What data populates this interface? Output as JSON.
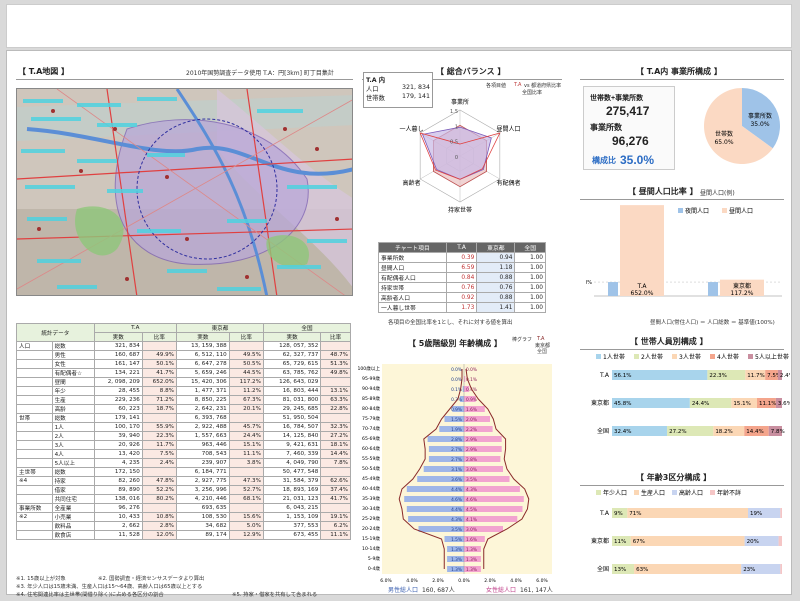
{
  "map_panel": {
    "title": "【 T.A地図 】",
    "note": "2010年国勢調査データ使用 T.A：円[3km] 町丁目集計"
  },
  "balance_panel": {
    "title": "【 総合バランス 】",
    "ta_label": "T.A 内",
    "population_label": "人口",
    "population_value": "321, 834",
    "households_label": "世帯数",
    "households_value": "179, 141",
    "legend_note": "各項目値",
    "legend_ta": "T.A",
    "legend_vs": "vs 都道府県比率",
    "legend_nat": "全国比率",
    "axes": [
      "事業所",
      "昼間人口",
      "有配偶者",
      "持家世帯",
      "高齢者",
      "一人暮し"
    ],
    "scale_labels": [
      "1.5",
      "1",
      "0.5",
      "0"
    ],
    "table_headers": [
      "チャート項目",
      "T.A",
      "東京都",
      "全国"
    ],
    "table_rows": [
      [
        "事業所数",
        "0.39",
        "0.94",
        "1.00"
      ],
      [
        "昼間人口",
        "6.59",
        "1.18",
        "1.00"
      ],
      [
        "有配偶者人口",
        "0.84",
        "0.88",
        "1.00"
      ],
      [
        "持家世帯",
        "0.76",
        "0.76",
        "1.00"
      ],
      [
        "高齢者人口",
        "0.92",
        "0.88",
        "1.00"
      ],
      [
        "一人暮し世帯",
        "1.73",
        "1.41",
        "1.00"
      ]
    ],
    "table_note": "各項目の全国比率を1とし、それに対する値を算出"
  },
  "establishment_panel": {
    "title": "【 T.A内 事業所構成 】",
    "label_total": "世帯数+事業所数",
    "value_total": "275,417",
    "label_est": "事業所数",
    "value_est": "96,276",
    "label_ratio": "構成比",
    "value_ratio": "35.0%",
    "pie_label_est": "事業所数",
    "pie_pct_est": "35.0%",
    "pie_label_hh": "世帯数",
    "pie_pct_hh": "65.0%",
    "share_est": 0.35,
    "color_est": "#9fc3e8",
    "color_hh": "#fbd9c3"
  },
  "daytime_panel": {
    "title": "【 昼間人口比率 】",
    "subtitle": "昼間人口(例)",
    "legend_night": "夜間人口",
    "legend_day": "昼間人口",
    "y_mid_label": "100%",
    "bars": [
      {
        "name": "T.A",
        "pct": "652.0%"
      },
      {
        "name": "東京都",
        "pct": "117.2%"
      }
    ],
    "formula": "昼間人口(常住人口) ＝ 人口総数 ＝ 基準値(100%)"
  },
  "household_panel": {
    "title": "【 世帯人員別構成 】",
    "legend": [
      "1人世帯",
      "2人世帯",
      "3人世帯",
      "4人世帯",
      "5人以上世帯"
    ],
    "colors": [
      "#a8d4ec",
      "#dde8b6",
      "#fbd7b5",
      "#f4a58c",
      "#c98fa0"
    ],
    "rows": [
      {
        "name": "T.A",
        "values": [
          56.1,
          22.3,
          11.7,
          7.5,
          2.4
        ],
        "labels": [
          "56.1%",
          "22.3%",
          "11.7%",
          "7.5%",
          "2.4%"
        ]
      },
      {
        "name": "東京都",
        "values": [
          45.8,
          24.4,
          15.1,
          11.1,
          3.6
        ],
        "labels": [
          "45.8%",
          "24.4%",
          "15.1%",
          "11.1%",
          "3.6%"
        ]
      },
      {
        "name": "全国",
        "values": [
          32.4,
          27.2,
          18.2,
          14.4,
          7.8
        ],
        "labels": [
          "32.4%",
          "27.2%",
          "18.2%",
          "14.4%",
          "7.8%"
        ]
      }
    ]
  },
  "age_panel": {
    "title": "【 年齢3区分構成 】",
    "legend": [
      "年少人口",
      "生産人口",
      "高齢人口",
      "年齢不詳"
    ],
    "colors": [
      "#dde8b6",
      "#fbd7b5",
      "#c8d4f0",
      "#f5c6c6"
    ],
    "rows": [
      {
        "name": "T.A",
        "values": [
          9,
          71,
          19,
          1
        ],
        "labels": [
          "9%",
          "71%",
          "19%",
          ""
        ]
      },
      {
        "name": "東京都",
        "values": [
          11,
          67,
          20,
          2
        ],
        "labels": [
          "11%",
          "67%",
          "20%",
          ""
        ]
      },
      {
        "name": "全国",
        "values": [
          13,
          63,
          23,
          1
        ],
        "labels": [
          "13%",
          "63%",
          "23%",
          ""
        ]
      }
    ]
  },
  "pyramid_panel": {
    "title": "【 5歳階級別 年齢構成 】",
    "legend_graph": "棒グラフ",
    "legend_line1": "T.A",
    "legend_line2": "東京都",
    "legend_line3": "全国",
    "male_label": "男性総人口",
    "male_value": "160, 687人",
    "female_label": "女性総人口",
    "female_value": "161, 147人",
    "axis_ticks": [
      "6.0%",
      "4.0%",
      "2.0%",
      "0.0%",
      "2.0%",
      "4.0%",
      "6.0%"
    ],
    "age_labels": [
      "100歳以上",
      "95-99歳",
      "90-94歳",
      "85-89歳",
      "80-84歳",
      "75-79歳",
      "70-74歳",
      "65-69歳",
      "60-64歳",
      "55-59歳",
      "50-54歳",
      "45-49歳",
      "40-44歳",
      "35-39歳",
      "30-34歳",
      "25-29歳",
      "20-24歳",
      "15-19歳",
      "10-14歳",
      "5-9歳",
      "0-4歳"
    ],
    "male": [
      0.0,
      0.0,
      0.1,
      0.3,
      0.9,
      1.5,
      1.9,
      2.8,
      2.7,
      2.7,
      3.1,
      3.6,
      4.4,
      4.6,
      4.4,
      4.3,
      3.5,
      1.5,
      1.3,
      1.3,
      1.3
    ],
    "female": [
      0.0,
      0.1,
      0.4,
      0.9,
      1.6,
      2.0,
      2.2,
      2.9,
      2.9,
      2.8,
      3.0,
      3.5,
      4.3,
      4.6,
      4.5,
      4.1,
      3.0,
      1.6,
      1.3,
      1.3,
      1.3
    ],
    "male_labels": [
      "0.0%",
      "0.0%",
      "0.1%",
      "0.3%",
      "0.9%",
      "1.5%",
      "1.9%",
      "2.8%",
      "2.7%",
      "2.7%",
      "3.1%",
      "3.6%",
      "4.4%",
      "4.6%",
      "4.4%",
      "4.3%",
      "3.5%",
      "1.5%",
      "1.3%",
      "1.3%",
      "1.3%"
    ],
    "female_labels": [
      "0.0%",
      "0.1%",
      "0.4%",
      "0.9%",
      "1.6%",
      "2.0%",
      "2.2%",
      "2.9%",
      "2.9%",
      "2.8%",
      "3.0%",
      "3.5%",
      "4.3%",
      "4.6%",
      "4.5%",
      "4.1%",
      "3.0%",
      "1.6%",
      "1.3%",
      "1.3%",
      "1.3%"
    ],
    "male_color": "#9fb6e8",
    "female_color": "#f2a3cf"
  },
  "stats_table": {
    "header_label": "統計データ",
    "region_headers": [
      "T.A",
      "東京都",
      "全国"
    ],
    "sub_headers": [
      "実数",
      "比率",
      "実数",
      "比率",
      "実数",
      "比率"
    ],
    "rows": [
      [
        "人口",
        "総数",
        "321, 834",
        "",
        "13, 159, 388",
        "",
        "128, 057, 352",
        ""
      ],
      [
        "",
        "男性",
        "160, 687",
        "49.9%",
        "6, 512, 110",
        "49.5%",
        "62, 327, 737",
        "48.7%"
      ],
      [
        "",
        "女性",
        "161, 147",
        "50.1%",
        "6, 647, 278",
        "50.5%",
        "65, 729, 615",
        "51.3%"
      ],
      [
        "",
        "有配偶者☆",
        "134, 221",
        "41.7%",
        "5, 659, 246",
        "44.5%",
        "63, 785, 762",
        "49.8%"
      ],
      [
        "",
        "昼間",
        "2, 098, 209",
        "652.0%",
        "15, 420, 306",
        "117.2%",
        "126, 643, 029",
        ""
      ],
      [
        "",
        "年少",
        "28, 455",
        "8.8%",
        "1, 477, 371",
        "11.2%",
        "16, 803, 444",
        "13.1%"
      ],
      [
        "",
        "生産",
        "229, 236",
        "71.2%",
        "8, 850, 225",
        "67.3%",
        "81, 031, 800",
        "63.3%"
      ],
      [
        "",
        "高齢",
        "60, 223",
        "18.7%",
        "2, 642, 231",
        "20.1%",
        "29, 245, 685",
        "22.8%"
      ],
      [
        "世帯",
        "総数",
        "179, 141",
        "",
        "6, 393, 768",
        "",
        "51, 950, 504",
        ""
      ],
      [
        "",
        "1人",
        "100, 170",
        "55.9%",
        "2, 922, 488",
        "45.7%",
        "16, 784, 507",
        "32.3%"
      ],
      [
        "",
        "2人",
        "39, 940",
        "22.3%",
        "1, 557, 663",
        "24.4%",
        "14, 125, 840",
        "27.2%"
      ],
      [
        "",
        "3人",
        "20, 926",
        "11.7%",
        "963, 446",
        "15.1%",
        "9, 421, 631",
        "18.1%"
      ],
      [
        "",
        "4人",
        "13, 420",
        "7.5%",
        "708, 543",
        "11.1%",
        "7, 460, 339",
        "14.4%"
      ],
      [
        "",
        "5人以上",
        "4, 235",
        "2.4%",
        "239, 907",
        "3.8%",
        "4, 049, 790",
        "7.8%"
      ],
      [
        "主世帯",
        "総数",
        "172, 150",
        "",
        "6, 184, 771",
        "",
        "50, 477, 548",
        ""
      ],
      [
        "※4",
        "持家",
        "82, 260",
        "47.8%",
        "2, 927, 775",
        "47.3%",
        "31, 584, 379",
        "62.6%"
      ],
      [
        "",
        "借家",
        "89, 890",
        "52.2%",
        "3, 256, 996",
        "52.7%",
        "18, 893, 169",
        "37.4%"
      ],
      [
        "",
        "共同住宅",
        "138, 016",
        "80.2%",
        "4, 210, 446",
        "68.1%",
        "21, 031, 123",
        "41.7%"
      ],
      [
        "事業所数",
        "全産業",
        "96, 276",
        "",
        "693, 635",
        "",
        "6, 043, 215",
        ""
      ],
      [
        "※2",
        "小売業",
        "10, 433",
        "10.8%",
        "108, 530",
        "15.6%",
        "1, 153, 109",
        "19.1%"
      ],
      [
        "",
        "飲料品",
        "2, 662",
        "2.8%",
        "34, 682",
        "5.0%",
        "377, 553",
        "6.2%"
      ],
      [
        "",
        "飲食店",
        "11, 528",
        "12.0%",
        "89, 174",
        "12.9%",
        "673, 455",
        "11.1%"
      ]
    ],
    "notes": [
      "※1. 15歳以上が対象",
      "※2. 国勢調査・経済センサスデータより算出",
      "※3. 年少人口は15歳未満、生産人口は15〜64歳、高齢人口は65歳以上とする",
      "※4. 住宅関連比率は主世帯(間借り除く)に占める各区分の割合",
      "※5. 持家・借家を共有して含まれる"
    ]
  }
}
